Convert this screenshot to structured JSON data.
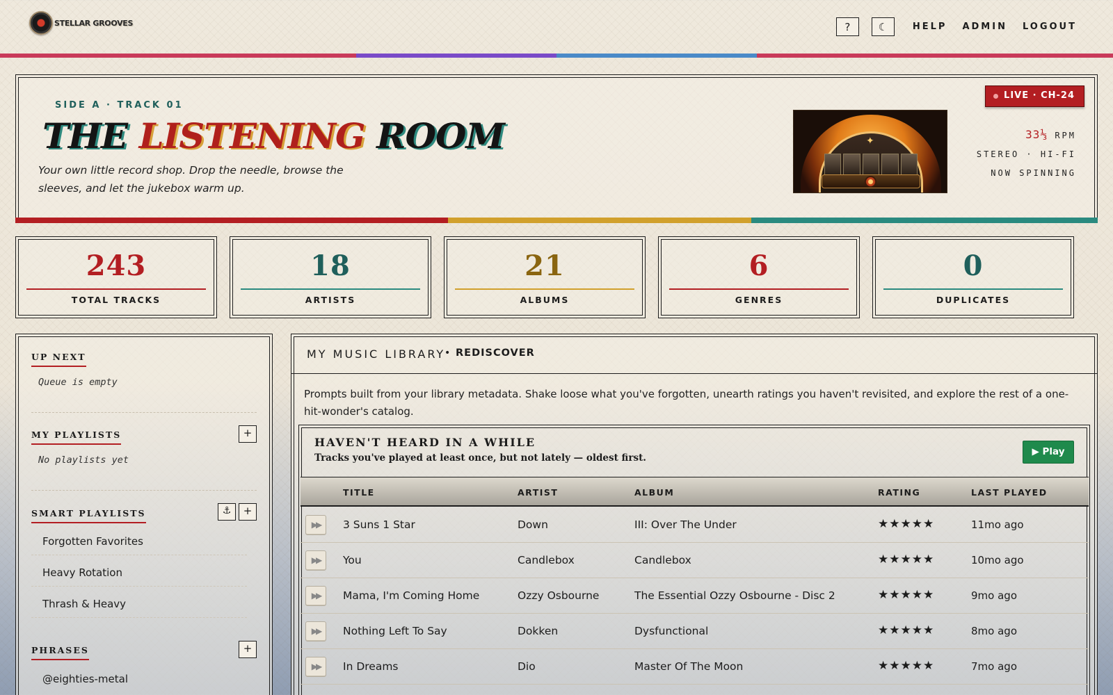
{
  "app": {
    "brand": "STELLAR GROOVES",
    "nav": {
      "help_icon": "?",
      "theme_icon": "☾",
      "links": [
        "HELP",
        "ADMIN",
        "LOGOUT"
      ]
    },
    "top_stripe_colors": [
      "#c93a5a",
      "#7a4ac8",
      "#4a8ac8",
      "#c93a5a"
    ]
  },
  "hero": {
    "kicker": "SIDE A · TRACK 01",
    "title_parts": [
      "THE",
      "LISTENING",
      "ROOM"
    ],
    "subtitle": "Your own little record shop. Drop the needle, browse the sleeves, and let the jukebox warm up.",
    "live_badge": "LIVE · CH-24",
    "rpm_value": "33⅓",
    "rpm_unit": "RPM",
    "lines": [
      "STEREO · HI-FI",
      "NOW SPINNING"
    ],
    "stripe_colors": [
      "#b31e22",
      "#d1a02c",
      "#2a8a7f"
    ]
  },
  "stats": [
    {
      "value": "243",
      "label": "TOTAL TRACKS",
      "color": "#b31e22",
      "rule": "#b31e22"
    },
    {
      "value": "18",
      "label": "ARTISTS",
      "color": "#1f5f5b",
      "rule": "#2a8a7f"
    },
    {
      "value": "21",
      "label": "ALBUMS",
      "color": "#8a6510",
      "rule": "#d1a02c"
    },
    {
      "value": "6",
      "label": "GENRES",
      "color": "#b31e22",
      "rule": "#b31e22"
    },
    {
      "value": "0",
      "label": "DUPLICATES",
      "color": "#1f5f5b",
      "rule": "#2a8a7f"
    }
  ],
  "sidebar": {
    "up_next": {
      "heading": "UP NEXT",
      "empty": "Queue is empty"
    },
    "my_playlists": {
      "heading": "MY PLAYLISTS",
      "empty": "No playlists yet",
      "add": "+"
    },
    "smart_playlists": {
      "heading": "SMART PLAYLISTS",
      "anchor_icon": "⚓",
      "add": "+",
      "items": [
        "Forgotten Favorites",
        "Heavy Rotation",
        "Thrash & Heavy"
      ]
    },
    "phrases": {
      "heading": "PHRASES",
      "add": "+",
      "items": [
        "@eighties-metal"
      ]
    }
  },
  "library": {
    "title": "MY MUSIC LIBRARY",
    "separator": "•",
    "tab": "REDISCOVER",
    "description": "Prompts built from your library metadata. Shake loose what you've forgotten, unearth ratings you haven't revisited, and explore the rest of a one-hit-wonder's catalog.",
    "card": {
      "title": "HAVEN'T HEARD IN A WHILE",
      "subtitle": "Tracks you've played at least once, but not lately — oldest first.",
      "play_label": "▶ Play",
      "columns": [
        "TITLE",
        "ARTIST",
        "ALBUM",
        "RATING",
        "LAST PLAYED"
      ],
      "row_play_icon": "▶▶",
      "rows": [
        {
          "title": "3 Suns 1 Star",
          "artist": "Down",
          "album": "III: Over The Under",
          "rating": "★★★★★",
          "last": "11mo ago"
        },
        {
          "title": "You",
          "artist": "Candlebox",
          "album": "Candlebox",
          "rating": "★★★★★",
          "last": "10mo ago"
        },
        {
          "title": "Mama, I'm Coming Home",
          "artist": "Ozzy Osbourne",
          "album": "The Essential Ozzy Osbourne - Disc 2",
          "rating": "★★★★★",
          "last": "9mo ago"
        },
        {
          "title": "Nothing Left To Say",
          "artist": "Dokken",
          "album": "Dysfunctional",
          "rating": "★★★★★",
          "last": "8mo ago"
        },
        {
          "title": "In Dreams",
          "artist": "Dio",
          "album": "Master Of The Moon",
          "rating": "★★★★★",
          "last": "7mo ago"
        }
      ]
    }
  }
}
